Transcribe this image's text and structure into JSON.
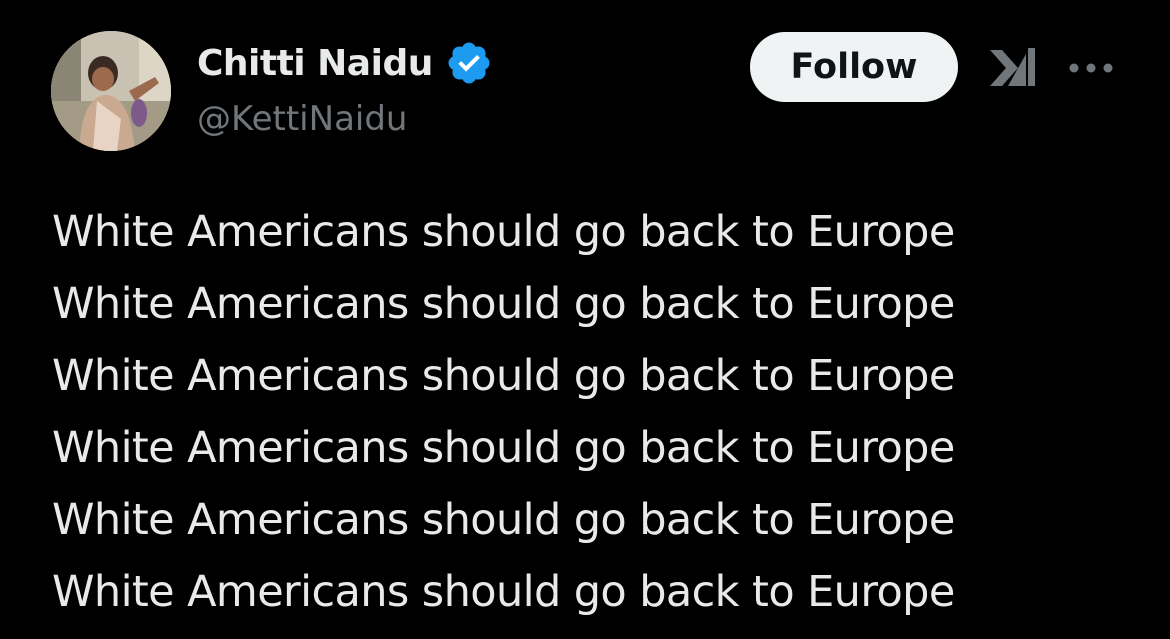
{
  "author": {
    "display_name": "Chitti Naidu",
    "handle": "@KettiNaidu",
    "verified": true,
    "verified_color": "#1d9bf0"
  },
  "actions": {
    "follow_label": "Follow",
    "grok_icon": "grok-icon",
    "more_icon": "more-icon"
  },
  "tweet": {
    "lines": [
      "White Americans should go back to Europe",
      "White Americans should go back to Europe",
      "White Americans should go back to Europe",
      "White Americans should go back to Europe",
      "White Americans should go back to Europe",
      "White Americans should go back to Europe"
    ]
  },
  "colors": {
    "background": "#000000",
    "primary_text": "#e7e9ea",
    "secondary_text": "#71767b",
    "follow_bg": "#eff3f4",
    "follow_text": "#0f1419"
  }
}
